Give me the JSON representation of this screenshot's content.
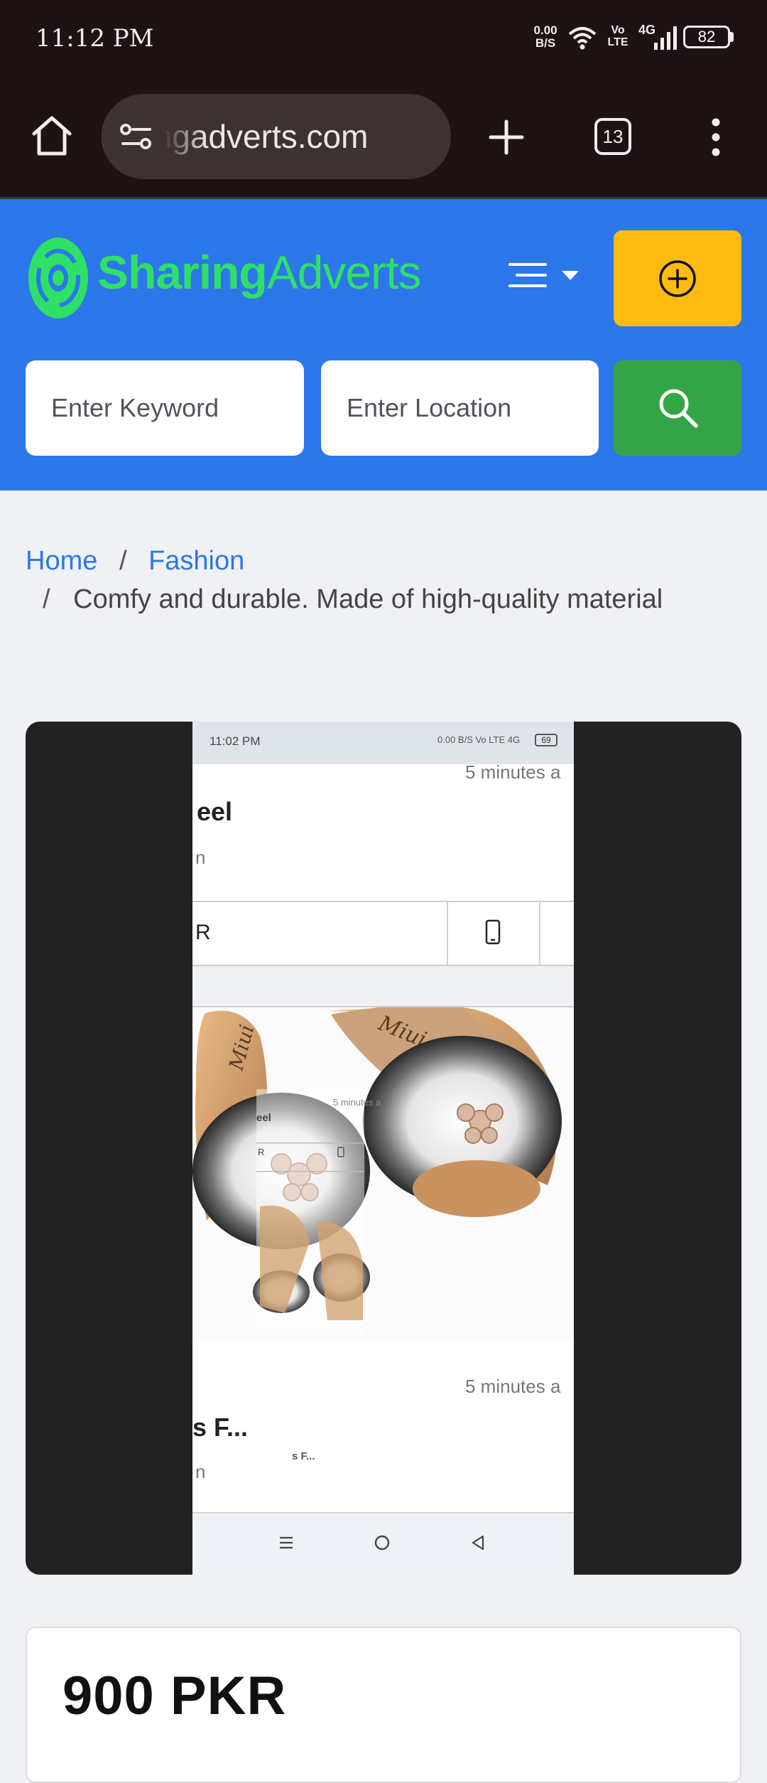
{
  "status_bar": {
    "time": "11:12 PM",
    "net_speed_value": "0.00",
    "net_speed_unit": "B/S",
    "volte_top": "Vo",
    "volte_bottom": "LTE",
    "network": "4G",
    "battery": "82"
  },
  "browser": {
    "url": "sharingadverts.com",
    "tab_count": "13"
  },
  "header": {
    "logo_part1": "Sharing",
    "logo_part2": "Adverts",
    "keyword_placeholder": "Enter Keyword",
    "location_placeholder": "Enter Location",
    "colors": {
      "header_bg": "#2c77ea",
      "post_button": "#ffbb10",
      "search_button": "#34a547",
      "logo_green": "#2fe067"
    }
  },
  "breadcrumb": {
    "home": "Home",
    "separator": "/",
    "category": "Fashion",
    "current": "Comfy and durable. Made of high-quality material"
  },
  "gallery": {
    "shot_time": "11:02 PM",
    "shot_status_right": "0.00 B/S  Vo LTE 4G",
    "shot_battery": "69",
    "time_ago_1": "5 minutes a",
    "title_fragment_1": "eel",
    "sub_fragment_1": "n",
    "price_fragment": "R",
    "title_fragment_2": "s F...",
    "sub_fragment_2": "n",
    "time_ago_2": "5 minutes a",
    "mini_time_ago": "5 minutes a",
    "mini_title": "s F...",
    "mini_heel": "eel",
    "mini_r": "R",
    "brand_on_sole": "Miui"
  },
  "listing": {
    "price": "900 PKR"
  }
}
